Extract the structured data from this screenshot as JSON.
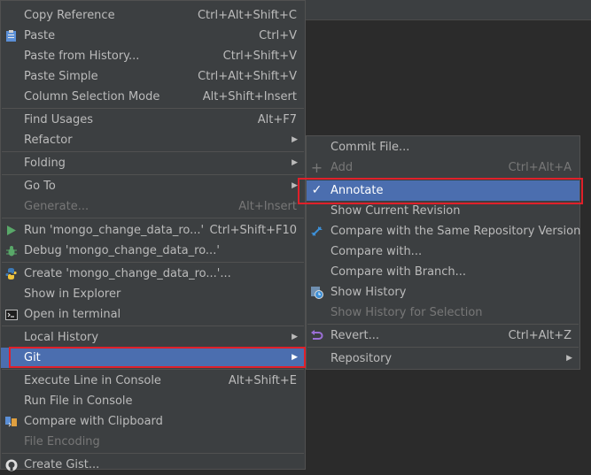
{
  "menu": {
    "items": [
      {
        "label": "Copy Reference",
        "shortcut": "Ctrl+Alt+Shift+C"
      },
      {
        "label": "Paste",
        "shortcut": "Ctrl+V",
        "icon": "clipboard-icon"
      },
      {
        "label": "Paste from History...",
        "shortcut": "Ctrl+Shift+V"
      },
      {
        "label": "Paste Simple",
        "shortcut": "Ctrl+Alt+Shift+V"
      },
      {
        "label": "Column Selection Mode",
        "shortcut": "Alt+Shift+Insert"
      },
      {
        "label": "Find Usages",
        "shortcut": "Alt+F7"
      },
      {
        "label": "Refactor"
      },
      {
        "label": "Folding"
      },
      {
        "label": "Go To"
      },
      {
        "label": "Generate...",
        "shortcut": "Alt+Insert",
        "disabled": true
      },
      {
        "label": "Run 'mongo_change_data_ro...'",
        "shortcut": "Ctrl+Shift+F10",
        "icon": "run-icon"
      },
      {
        "label": "Debug 'mongo_change_data_ro...'",
        "icon": "debug-bug-icon"
      },
      {
        "label": "Create 'mongo_change_data_ro...'...",
        "icon": "python-icon"
      },
      {
        "label": "Show in Explorer"
      },
      {
        "label": "Open in terminal",
        "icon": "terminal-icon"
      },
      {
        "label": "Local History"
      },
      {
        "label": "Git",
        "selected": true
      },
      {
        "label": "Execute Line in Console",
        "shortcut": "Alt+Shift+E"
      },
      {
        "label": "Run File in Console"
      },
      {
        "label": "Compare with Clipboard",
        "icon": "compare-icon"
      },
      {
        "label": "File Encoding",
        "disabled": true
      },
      {
        "label": "Create Gist...",
        "icon": "github-icon"
      }
    ]
  },
  "git_submenu": {
    "items": [
      {
        "label": "Commit File..."
      },
      {
        "label": "Add",
        "shortcut": "Ctrl+Alt+A",
        "disabled": true,
        "icon": "plus-icon"
      },
      {
        "label": "Annotate",
        "selected": true,
        "icon": "checkmark-icon"
      },
      {
        "label": "Show Current Revision"
      },
      {
        "label": "Compare with the Same Repository Version",
        "icon": "compare-arrows-icon"
      },
      {
        "label": "Compare with..."
      },
      {
        "label": "Compare with Branch..."
      },
      {
        "label": "Show History",
        "icon": "history-clock-icon"
      },
      {
        "label": "Show History for Selection",
        "disabled": true
      },
      {
        "label": "Revert...",
        "shortcut": "Ctrl+Alt+Z",
        "icon": "revert-arrow-icon"
      },
      {
        "label": "Repository"
      }
    ]
  },
  "colors": {
    "menu_background": "#3c3f41",
    "selection": "#4b6eaf",
    "highlight_border": "#e0202a",
    "text": "#bbbbbb",
    "disabled_text": "#777777"
  }
}
